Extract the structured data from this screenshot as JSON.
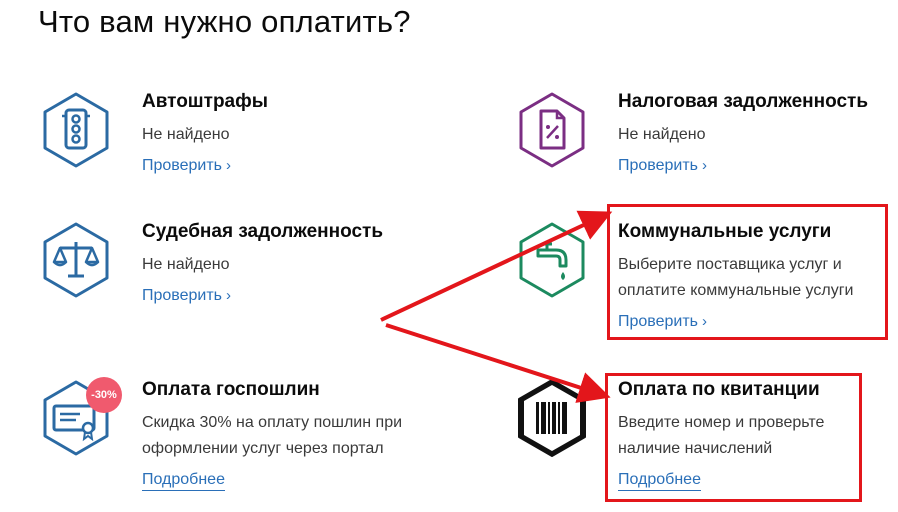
{
  "page": {
    "title": "Что вам нужно оплатить?"
  },
  "colors": {
    "blue": "#2b6aa3",
    "purple": "#7b2e83",
    "green": "#1c8a5f",
    "link": "#2a6fb8",
    "highlight": "#e3161b",
    "discount": "#f05a6e"
  },
  "cards": {
    "auto": {
      "title": "Автоштрафы",
      "desc": "Не найдено",
      "link": "Проверить",
      "icon": "traffic-light-icon"
    },
    "tax": {
      "title": "Налоговая задолженность",
      "desc": "Не найдено",
      "link": "Проверить",
      "icon": "tax-document-icon"
    },
    "court": {
      "title": "Судебная задолженность",
      "desc": "Не найдено",
      "link": "Проверить",
      "icon": "scales-icon"
    },
    "comm": {
      "title": "Коммунальные услуги",
      "desc": "Выберите поставщика услуг и оплатите коммунальные услуги",
      "link": "Проверить",
      "icon": "water-tap-icon"
    },
    "duty": {
      "title": "Оплата госпошлин",
      "desc": "Скидка 30% на оплату пошлин при оформлении услуг через портал",
      "link": "Подробнее",
      "icon": "certificate-icon",
      "badge": "-30%"
    },
    "receipt": {
      "title": "Оплата по квитанции",
      "desc": "Введите номер и проверьте наличие начислений",
      "link": "Подробнее",
      "icon": "barcode-icon"
    }
  }
}
